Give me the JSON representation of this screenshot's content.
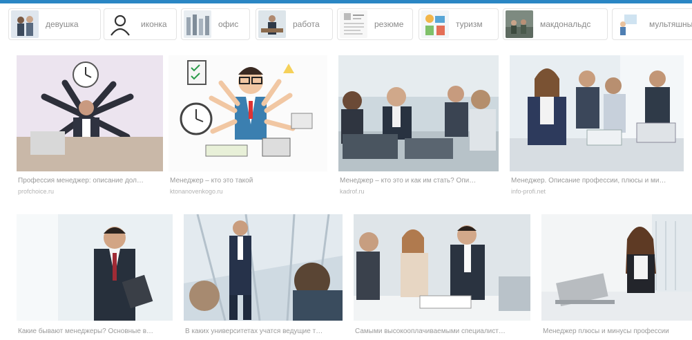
{
  "chips": [
    {
      "label": "девушка"
    },
    {
      "label": "иконка"
    },
    {
      "label": "офис"
    },
    {
      "label": "работа"
    },
    {
      "label": "резюме"
    },
    {
      "label": "туризм"
    },
    {
      "label": "макдональдс"
    },
    {
      "label": "мультяшные"
    }
  ],
  "results": [
    {
      "caption": "Профессия менеджер: описание дол…",
      "site": "profchoice.ru"
    },
    {
      "caption": "Менеджер – кто это такой",
      "site": "ktonanovenkogo.ru"
    },
    {
      "caption": "Менеджер – кто это и как им стать? Опи…",
      "site": "kadrof.ru"
    },
    {
      "caption": "Менеджер. Описание профессии, плюсы и ми…",
      "site": "info-profi.net"
    },
    {
      "caption": "Какие бывают менеджеры? Основные в…",
      "site": ""
    },
    {
      "caption": "В каких университетах учатся ведущие т…",
      "site": ""
    },
    {
      "caption": "Самыми высокооплачиваемыми специалист…",
      "site": ""
    },
    {
      "caption": "Менеджер плюсы и минусы профессии",
      "site": ""
    }
  ],
  "colors": {
    "accent_bar": "#2a86c4",
    "caption": "#9a9a9a",
    "site": "#b3b3b3"
  }
}
